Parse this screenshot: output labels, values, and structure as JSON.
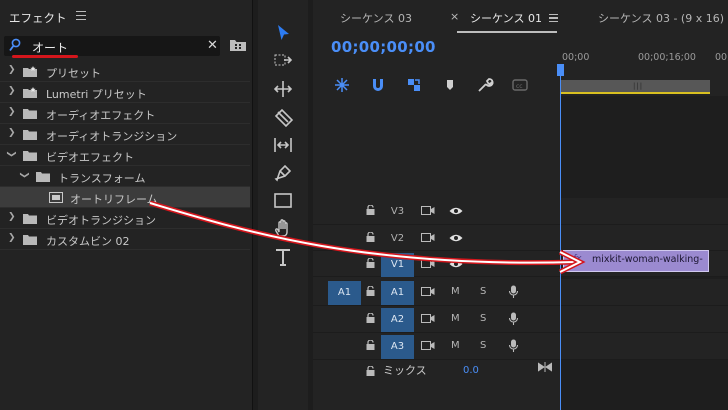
{
  "effects_panel": {
    "title": "エフェクト",
    "search": {
      "value": "オート"
    },
    "tree": [
      {
        "label": "プリセット",
        "icon": "star-folder-icon",
        "expanded": false
      },
      {
        "label": "Lumetri プリセット",
        "icon": "star-folder-icon",
        "expanded": false
      },
      {
        "label": "オーディオエフェクト",
        "icon": "folder-icon",
        "expanded": false
      },
      {
        "label": "オーディオトランジション",
        "icon": "folder-icon",
        "expanded": false
      },
      {
        "label": "ビデオエフェクト",
        "icon": "folder-icon",
        "expanded": true
      },
      {
        "label": "トランスフォーム",
        "icon": "folder-icon",
        "expanded": true
      },
      {
        "label": "オートリフレーム",
        "icon": "effect-icon",
        "selected": true
      },
      {
        "label": "ビデオトランジション",
        "icon": "folder-icon",
        "expanded": false
      },
      {
        "label": "カスタムビン 02",
        "icon": "folder-icon",
        "expanded": false
      }
    ]
  },
  "timeline": {
    "tabs": [
      {
        "label": "シーケンス 03"
      },
      {
        "label": "シーケンス 01",
        "active": true
      },
      {
        "label": "シーケンス 03 - (9 x 16)"
      }
    ],
    "timecode": "00;00;00;00",
    "ruler": [
      "00;00",
      "00;00;16;00",
      "00;0"
    ],
    "tracks": {
      "video": [
        {
          "label": "V3",
          "targeted": false
        },
        {
          "label": "V2",
          "targeted": false
        },
        {
          "label": "V1",
          "targeted": true
        }
      ],
      "audio": [
        {
          "label": "A1",
          "source": "A1",
          "targeted": true
        },
        {
          "label": "A2",
          "targeted": true
        },
        {
          "label": "A3",
          "targeted": true
        }
      ],
      "mute": "M",
      "solo": "S"
    },
    "clip": {
      "fx": "fx",
      "name": "mixkit-woman-walking-"
    },
    "mix": {
      "label": "ミックス",
      "value": "0.0"
    }
  },
  "colors": {
    "accent": "#4a8ef7",
    "clip": "#9b8ad0",
    "target": "#2b5a8c",
    "annotation": "#d4161c"
  }
}
